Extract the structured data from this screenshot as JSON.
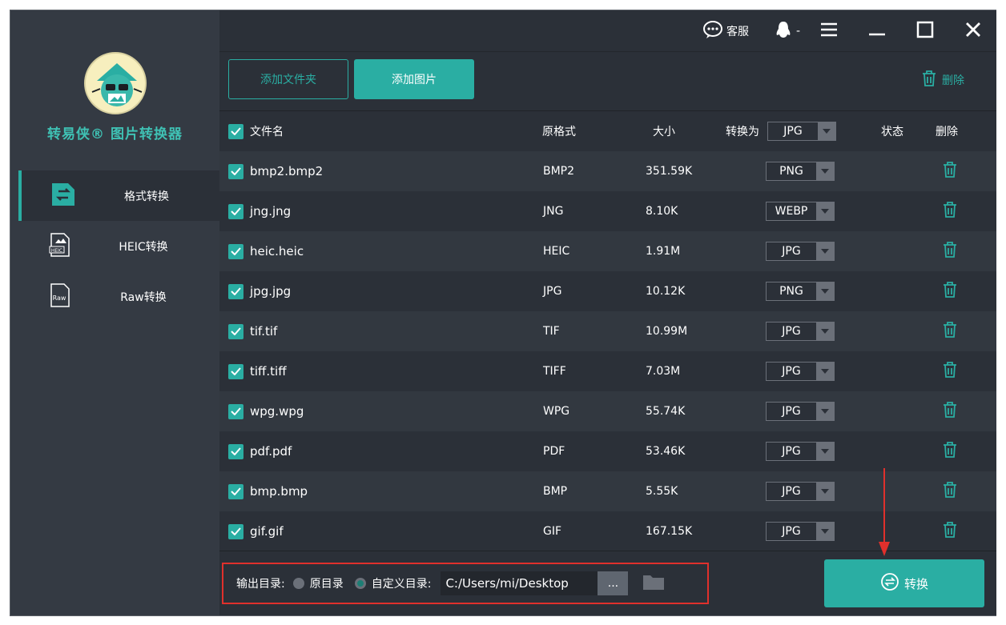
{
  "app": {
    "title": "转易侠® 图片转换器",
    "accent": "#2aaea3"
  },
  "sidebar": {
    "items": [
      {
        "label": "格式转换",
        "icon": "format-convert-icon",
        "active": true
      },
      {
        "label": "HEIC转换",
        "icon": "heic-file-icon",
        "active": false
      },
      {
        "label": "Raw转换",
        "icon": "raw-file-icon",
        "active": false
      }
    ]
  },
  "topbar": {
    "support_label": "客服",
    "user_label": "-"
  },
  "toolbar": {
    "add_folder_label": "添加文件夹",
    "add_image_label": "添加图片",
    "delete_label": "删除"
  },
  "table": {
    "headers": {
      "filename": "文件名",
      "format": "原格式",
      "size": "大小",
      "convert_to": "转换为",
      "status": "状态",
      "delete": "删除"
    },
    "global_target": "JPG",
    "rows": [
      {
        "name": "bmp2.bmp2",
        "format": "BMP2",
        "size": "351.59K",
        "target": "PNG"
      },
      {
        "name": "jng.jng",
        "format": "JNG",
        "size": "8.10K",
        "target": "WEBP"
      },
      {
        "name": "heic.heic",
        "format": "HEIC",
        "size": "1.91M",
        "target": "JPG"
      },
      {
        "name": "jpg.jpg",
        "format": "JPG",
        "size": "10.12K",
        "target": "PNG"
      },
      {
        "name": "tif.tif",
        "format": "TIF",
        "size": "10.99M",
        "target": "JPG"
      },
      {
        "name": "tiff.tiff",
        "format": "TIFF",
        "size": "7.03M",
        "target": "JPG"
      },
      {
        "name": "wpg.wpg",
        "format": "WPG",
        "size": "55.74K",
        "target": "JPG"
      },
      {
        "name": "pdf.pdf",
        "format": "PDF",
        "size": "53.46K",
        "target": "JPG"
      },
      {
        "name": "bmp.bmp",
        "format": "BMP",
        "size": "5.55K",
        "target": "JPG"
      },
      {
        "name": "gif.gif",
        "format": "GIF",
        "size": "167.15K",
        "target": "JPG"
      }
    ]
  },
  "footer": {
    "output_label": "输出目录:",
    "option_original": "原目录",
    "option_custom": "自定义目录:",
    "path": "C:/Users/mi/Desktop",
    "browse_label": "...",
    "convert_label": "转换"
  }
}
